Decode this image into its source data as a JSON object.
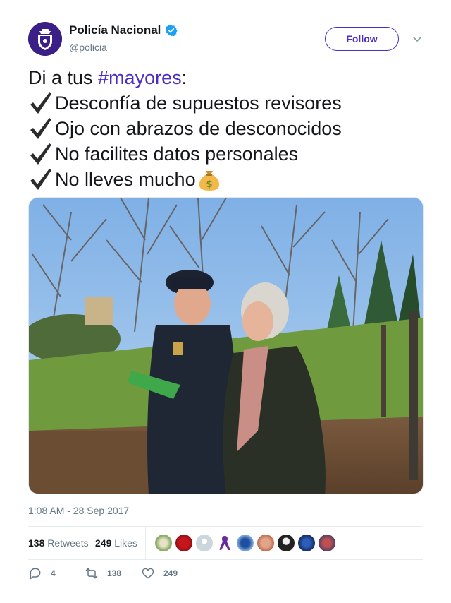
{
  "author": {
    "display_name": "Policía Nacional",
    "handle": "@policia",
    "verified": true,
    "avatar_icon": "police-badge-icon",
    "brand_color": "#3b1e86"
  },
  "follow_button": {
    "label": "Follow",
    "color": "#4a2ec5"
  },
  "menu": {
    "icon": "chevron-down-icon"
  },
  "tweet": {
    "intro_text": "Di a tus ",
    "hashtag": "#mayores",
    "intro_suffix": ":",
    "lines": [
      "Desconfía de supuestos revisores",
      "Ojo con abrazos de desconocidos",
      "No facilites datos personales",
      "No lleves mucho"
    ],
    "check_icon": "heavy-check-mark-icon",
    "money_icon": "money-bag-icon"
  },
  "media": {
    "icon": "photo-police-officer-elderly-man-park"
  },
  "timestamp": "1:08 AM - 28 Sep 2017",
  "stats": {
    "retweets_count": "138",
    "retweets_label": "Retweets",
    "likes_count": "249",
    "likes_label": "Likes"
  },
  "actions": {
    "reply_count": "4",
    "retweet_count": "138",
    "like_count": "249"
  },
  "colors": {
    "text": "#14171a",
    "secondary": "#657786",
    "link": "#4a2ec5",
    "verified": "#1da1f2"
  }
}
